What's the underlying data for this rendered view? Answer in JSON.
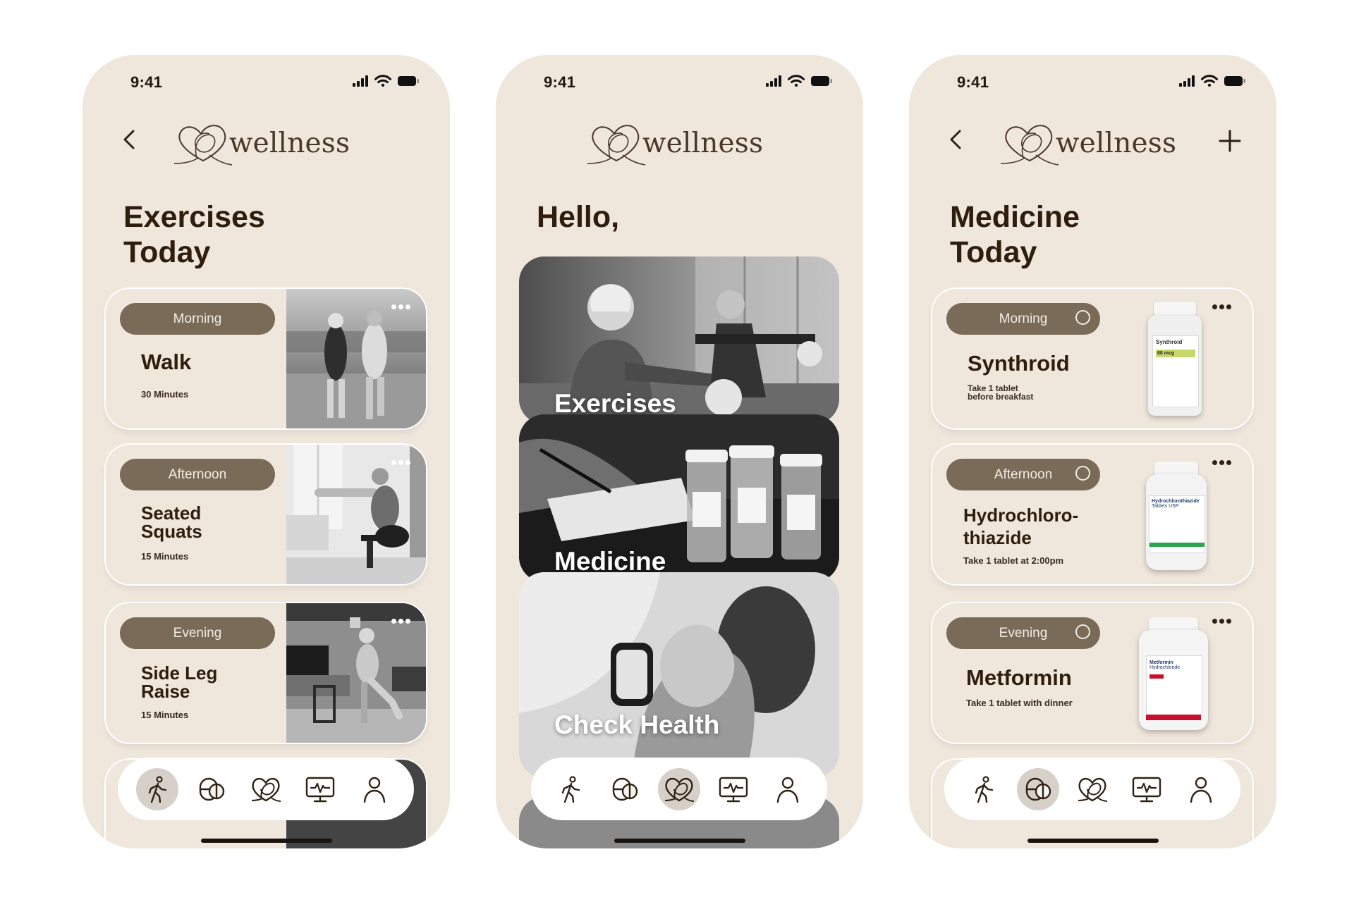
{
  "status": {
    "time": "9:41"
  },
  "brand": {
    "name": "wellness"
  },
  "exercises_screen": {
    "title_line1": "Exercises",
    "title_line2": "Today",
    "cards": [
      {
        "period": "Morning",
        "title_lines": [
          "Walk"
        ],
        "subtitle": "30 Minutes"
      },
      {
        "period": "Afternoon",
        "title_lines": [
          "Seated",
          "Squats"
        ],
        "subtitle": "15 Minutes"
      },
      {
        "period": "Evening",
        "title_lines": [
          "Side Leg",
          "Raise"
        ],
        "subtitle": "15 Minutes"
      }
    ]
  },
  "home_screen": {
    "greeting": "Hello,",
    "tiles": [
      {
        "label": "Exercises"
      },
      {
        "label": "Medicine"
      },
      {
        "label": "Check Health"
      }
    ]
  },
  "medicine_screen": {
    "title_line1": "Medicine",
    "title_line2": "Today",
    "cards": [
      {
        "period": "Morning",
        "title_lines": [
          "Synthroid"
        ],
        "instructions_lines": [
          "Take 1 tablet",
          "before breakfast"
        ],
        "label_lines": [
          "Synthroid",
          "88 mcg"
        ]
      },
      {
        "period": "Afternoon",
        "title_lines": [
          "Hydrochloro-",
          "thiazide"
        ],
        "instructions_lines": [
          "Take 1 tablet at 2:00pm"
        ],
        "label_lines": [
          "Hydrochlorothiazide",
          "Tablets USP"
        ]
      },
      {
        "period": "Evening",
        "title_lines": [
          "Metformin"
        ],
        "instructions_lines": [
          "Take 1 tablet with dinner"
        ],
        "label_lines": [
          "Metformin",
          "Hydrochloride"
        ]
      }
    ]
  },
  "nav": {
    "items": [
      {
        "icon": "walking-person-icon"
      },
      {
        "icon": "pill-capsules-icon"
      },
      {
        "icon": "heart-wellness-icon"
      },
      {
        "icon": "heart-monitor-icon"
      },
      {
        "icon": "profile-person-icon"
      }
    ],
    "active_by_screen": {
      "exercises": 0,
      "home": 2,
      "medicine": 1
    }
  },
  "colors": {
    "background": "#ffffff",
    "phone": "#efe6dc",
    "pill": "#7a6b59",
    "text": "#2f1e0d",
    "nav_active": "#d7d0c8"
  }
}
